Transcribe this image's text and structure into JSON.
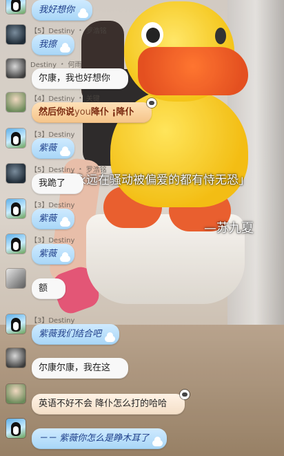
{
  "overlay": {
    "quote": "永远在骚动被偏爱的都有恃无恐",
    "quote_open": "「",
    "quote_close": "」",
    "author": "—苏九夏"
  },
  "messages": [
    {
      "sender": "",
      "text": "我好想你",
      "style": "blue",
      "avatar": "penguin",
      "avatar_icon": "penguin-avatar-icon"
    },
    {
      "sender": "【5】Destiny ﹡ 罗浩铭",
      "text": "我擦",
      "style": "blue",
      "avatar": "dark",
      "avatar_icon": "dark-photo-avatar-icon"
    },
    {
      "sender": "Destiny ﹡ 何雨",
      "text": "尔康，我也好想你",
      "style": "white",
      "avatar": "bw",
      "avatar_icon": "bw-photo-avatar-icon"
    },
    {
      "sender": "【4】Destiny ﹡ 关键",
      "text_pre": "然后你说",
      "text_en": "you",
      "text_post": "降仆 ¡降仆",
      "style": "orange",
      "avatar": "photo",
      "avatar_icon": "photo-avatar-icon"
    },
    {
      "sender": "【3】Destiny",
      "text": "紫薇",
      "style": "blue",
      "avatar": "penguin",
      "avatar_icon": "penguin-avatar-icon"
    },
    {
      "sender": "【5】Destiny ﹡ 罗浩铭",
      "text": "我跪了",
      "style": "white",
      "avatar": "dark",
      "avatar_icon": "dark-photo-avatar-icon"
    },
    {
      "sender": "【3】Destiny",
      "text": "紫薇",
      "style": "blue",
      "avatar": "penguin",
      "avatar_icon": "penguin-avatar-icon"
    },
    {
      "sender": "【3】Destiny",
      "text": "紫薇",
      "style": "blue",
      "avatar": "penguin",
      "avatar_icon": "penguin-avatar-icon"
    },
    {
      "sender": "",
      "text": "额",
      "style": "white",
      "avatar": "bw2",
      "avatar_icon": "bw-photo-avatar-icon"
    },
    {
      "sender": "【3】Destiny",
      "text": "紫薇我们结合吧",
      "style": "blue",
      "avatar": "penguin",
      "avatar_icon": "penguin-avatar-icon"
    },
    {
      "sender": "",
      "text": "尔康尔康，我在这",
      "style": "white",
      "avatar": "bw",
      "avatar_icon": "bw-photo-avatar-icon"
    },
    {
      "sender": "",
      "text": "英语不好不会 降仆怎么打的哈哈",
      "style": "dark",
      "avatar": "photo",
      "avatar_icon": "photo-avatar-icon"
    },
    {
      "sender": "",
      "text": "－－ 紫薇你怎么是睁木耳了",
      "style": "blue",
      "avatar": "penguin",
      "avatar_icon": "penguin-avatar-icon"
    }
  ]
}
